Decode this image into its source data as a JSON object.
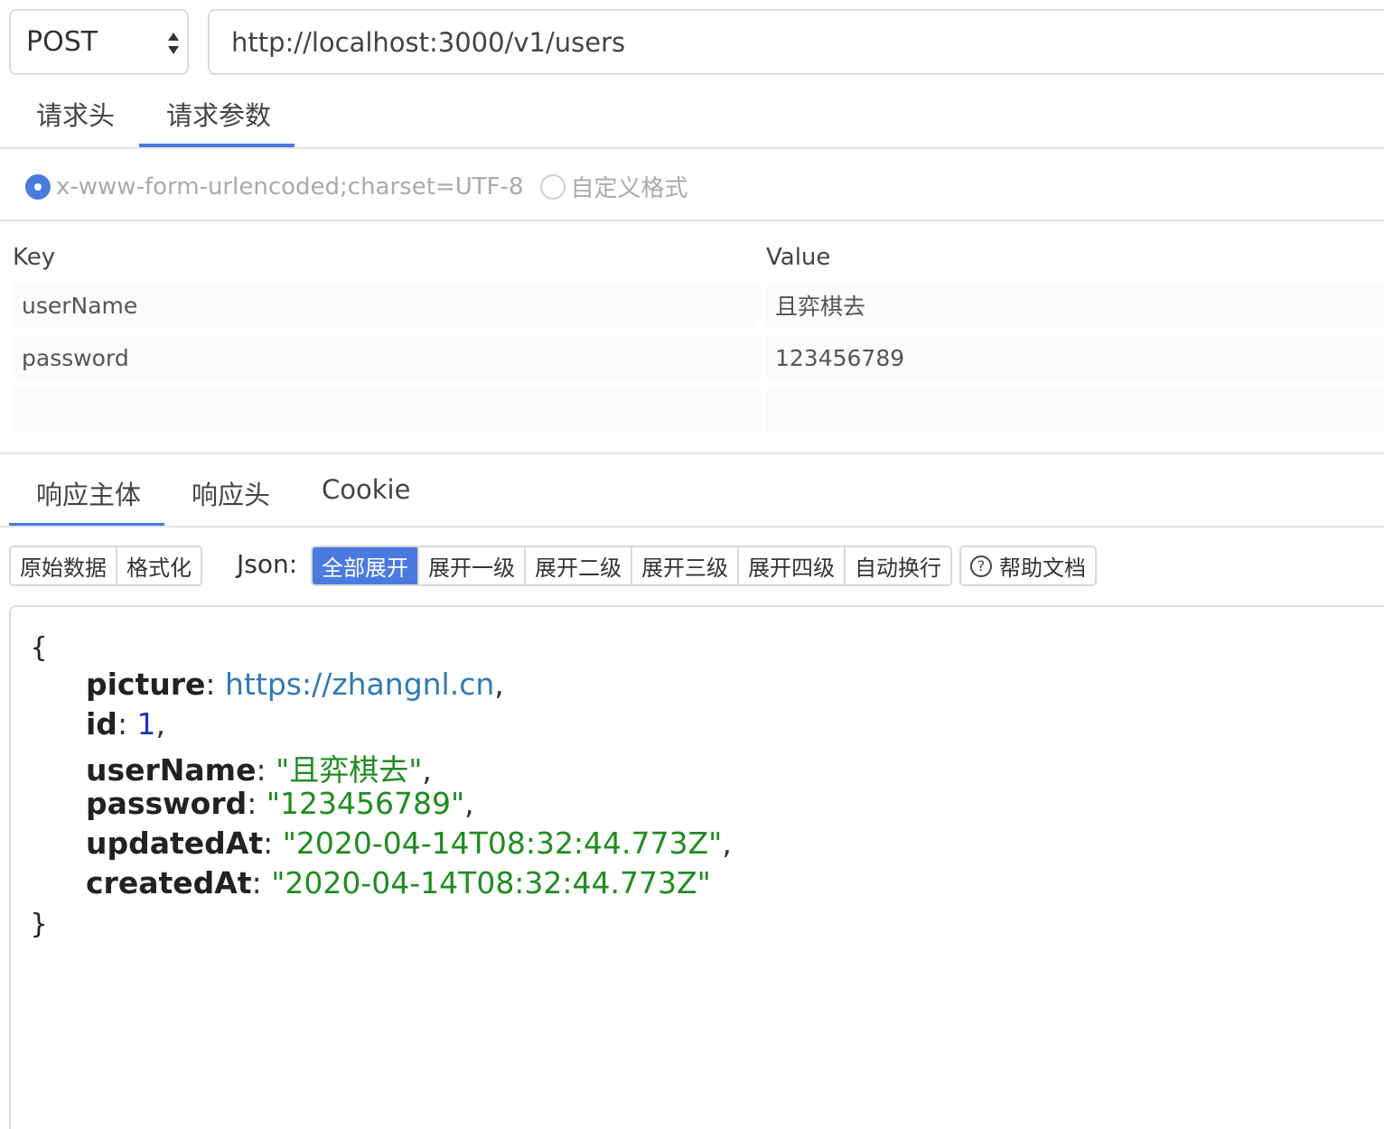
{
  "request": {
    "method": "POST",
    "url": "http://localhost:3000/v1/users"
  },
  "request_tabs": [
    "请求头",
    "请求参数"
  ],
  "active_request_tab": "请求参数",
  "encoding": {
    "options": [
      "x-www-form-urlencoded;charset=UTF-8",
      "自定义格式"
    ],
    "selected": "x-www-form-urlencoded;charset=UTF-8"
  },
  "params": {
    "key_header": "Key",
    "value_header": "Value",
    "rows": [
      {
        "key": "userName",
        "value": "且弈棋去"
      },
      {
        "key": "password",
        "value": "123456789"
      },
      {
        "key": "",
        "value": ""
      }
    ]
  },
  "response_tabs": [
    "响应主体",
    "响应头",
    "Cookie"
  ],
  "active_response_tab": "响应主体",
  "toolbar": {
    "view_modes": [
      "原始数据",
      "格式化"
    ],
    "json_label": "Json:",
    "expand_options": [
      "全部展开",
      "展开一级",
      "展开二级",
      "展开三级",
      "展开四级",
      "自动换行"
    ],
    "active_expand": "全部展开",
    "help_label": "帮助文档",
    "help_icon": "help-circle-icon"
  },
  "response": {
    "open_brace": "{",
    "close_brace": "}",
    "fields": [
      {
        "key": "picture",
        "value": "https://zhangnl.cn",
        "sep": ","
      },
      {
        "key": "id",
        "value": "1",
        "sep": ","
      },
      {
        "key": "userName",
        "value": "\"且弈棋去\"",
        "sep": ","
      },
      {
        "key": "password",
        "value": "\"123456789\"",
        "sep": ","
      },
      {
        "key": "updatedAt",
        "value": "\"2020-04-14T08:32:44.773Z\"",
        "sep": ","
      },
      {
        "key": "createdAt",
        "value": "\"2020-04-14T08:32:44.773Z\"",
        "sep": ""
      }
    ]
  },
  "colors": {
    "accent": "#4a7ae0",
    "json_link": "#2f7ab3",
    "json_number": "#2233bb",
    "json_string": "#1f8c1f"
  }
}
